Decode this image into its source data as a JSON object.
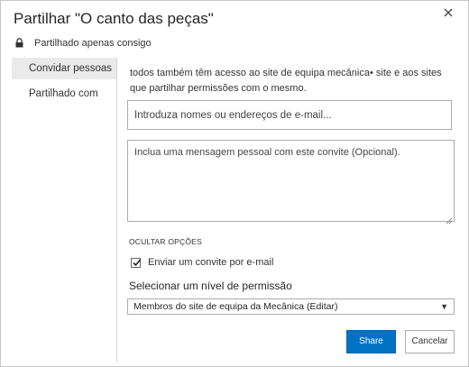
{
  "dialog": {
    "title": "Partilhar \"O canto das peças\"",
    "close_icon": "close-icon"
  },
  "status": {
    "icon": "lock-icon",
    "text": "Partilhado apenas consigo"
  },
  "sidebar": {
    "items": [
      {
        "label": "Convidar pessoas",
        "active": true
      },
      {
        "label": "Partilhado com",
        "active": false
      }
    ]
  },
  "invite": {
    "info_text": "todos também têm acesso ao site de equipa mecânica• site e aos sites que partilhar permissões com o mesmo.",
    "names_placeholder": "Introduza nomes ou endereços de e-mail...",
    "names_value": "",
    "message_placeholder": "Inclua uma mensagem pessoal com este convite (Opcional).",
    "message_value": "",
    "hide_options_label": "OCULTAR OPÇÕES",
    "send_email_label": "Enviar um convite por e-mail",
    "send_email_checked": true,
    "permission_label": "Selecionar um nível de permissão",
    "permission_selected": "Membros do site de equipa da Mecânica (Editar)"
  },
  "buttons": {
    "share": "Share",
    "cancel": "Cancelar"
  },
  "colors": {
    "accent": "#0072c6",
    "active_tab_bg": "#eaeaea"
  }
}
